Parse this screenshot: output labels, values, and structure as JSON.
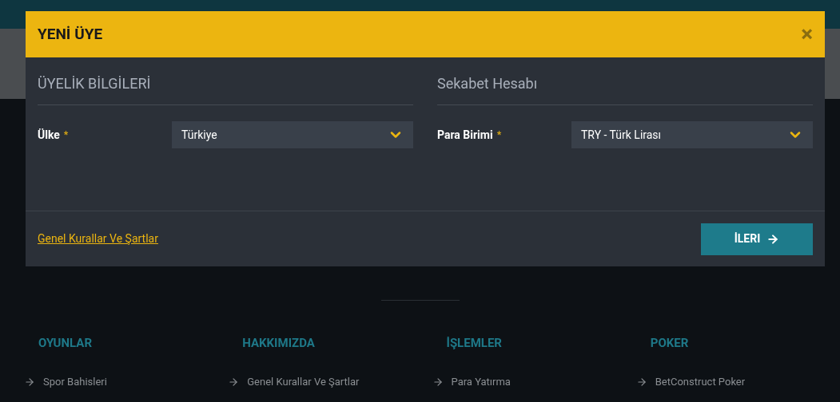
{
  "modal": {
    "title": "YENİ ÜYE",
    "close": "×",
    "sections": [
      {
        "title": "ÜYELİK BİLGİLERİ",
        "field": {
          "label": "Ülke",
          "required": "*",
          "value": "Türkiye"
        }
      },
      {
        "title": "Sekabet Hesabı",
        "field": {
          "label": "Para Birimi",
          "required": "*",
          "value": "TRY - Türk Lirası"
        }
      }
    ],
    "terms_link": "Genel Kurallar Ve Şartlar",
    "next_button": "İLERI"
  },
  "footer": {
    "columns": [
      {
        "heading": "OYUNLAR",
        "link": "Spor Bahisleri"
      },
      {
        "heading": "HAKKIMIZDA",
        "link": "Genel Kurallar Ve Şartlar"
      },
      {
        "heading": "İŞLEMLER",
        "link": "Para Yatırma"
      },
      {
        "heading": "POKER",
        "link": "BetConstruct Poker"
      }
    ]
  }
}
